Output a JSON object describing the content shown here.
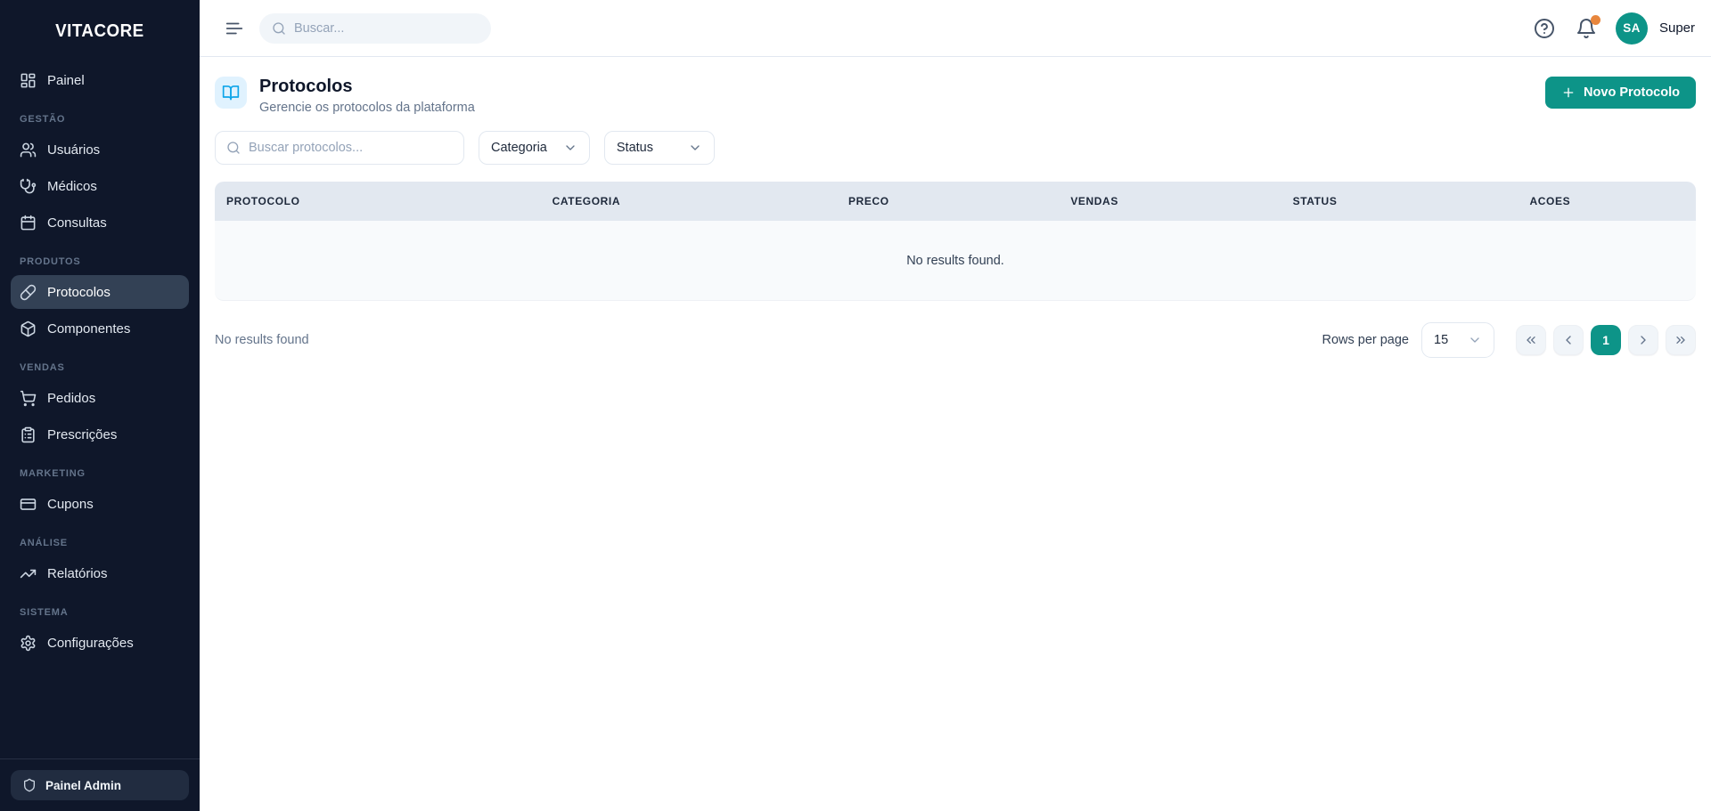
{
  "brand": "VITACORE",
  "colors": {
    "accent_teal": "#0d9488",
    "sidebar_bg": "#0f172a",
    "sidebar_active_bg": "#334155",
    "page_icon_blue": "#0ea5e9",
    "page_icon_bg": "#e0f2fe",
    "notification_dot": "#e8863d",
    "table_header_bg": "#e2e8f0",
    "table_body_bg": "#f8fafc"
  },
  "sidebar": {
    "sections": [
      {
        "label": "",
        "items": [
          {
            "label": "Painel",
            "icon": "dashboard",
            "active": false
          }
        ]
      },
      {
        "label": "GESTÃO",
        "items": [
          {
            "label": "Usuários",
            "icon": "users",
            "active": false
          },
          {
            "label": "Médicos",
            "icon": "stethoscope",
            "active": false
          },
          {
            "label": "Consultas",
            "icon": "calendar",
            "active": false
          }
        ]
      },
      {
        "label": "PRODUTOS",
        "items": [
          {
            "label": "Protocolos",
            "icon": "pill",
            "active": true
          },
          {
            "label": "Componentes",
            "icon": "package",
            "active": false
          }
        ]
      },
      {
        "label": "VENDAS",
        "items": [
          {
            "label": "Pedidos",
            "icon": "cart",
            "active": false
          },
          {
            "label": "Prescrições",
            "icon": "clipboard",
            "active": false
          }
        ]
      },
      {
        "label": "MARKETING",
        "items": [
          {
            "label": "Cupons",
            "icon": "credit-card",
            "active": false
          }
        ]
      },
      {
        "label": "ANÁLISE",
        "items": [
          {
            "label": "Relatórios",
            "icon": "trending-up",
            "active": false
          }
        ]
      },
      {
        "label": "SISTEMA",
        "items": [
          {
            "label": "Configurações",
            "icon": "settings",
            "active": false
          }
        ]
      }
    ],
    "footer_label": "Painel Admin"
  },
  "topbar": {
    "search_placeholder": "Buscar...",
    "user_initials": "SA",
    "user_name": "Super"
  },
  "page": {
    "title": "Protocolos",
    "subtitle": "Gerencie os protocolos da plataforma",
    "new_button_label": "Novo Protocolo",
    "search_placeholder": "Buscar protocolos...",
    "filters": [
      "Categoria",
      "Status"
    ]
  },
  "table": {
    "columns": [
      "PROTOCOLO",
      "CATEGORIA",
      "PRECO",
      "VENDAS",
      "STATUS",
      "ACOES"
    ],
    "empty_text": "No results found."
  },
  "footer": {
    "empty_text": "No results found",
    "rows_per_page_label": "Rows per page",
    "rows_per_page_value": "15",
    "current_page": "1"
  }
}
